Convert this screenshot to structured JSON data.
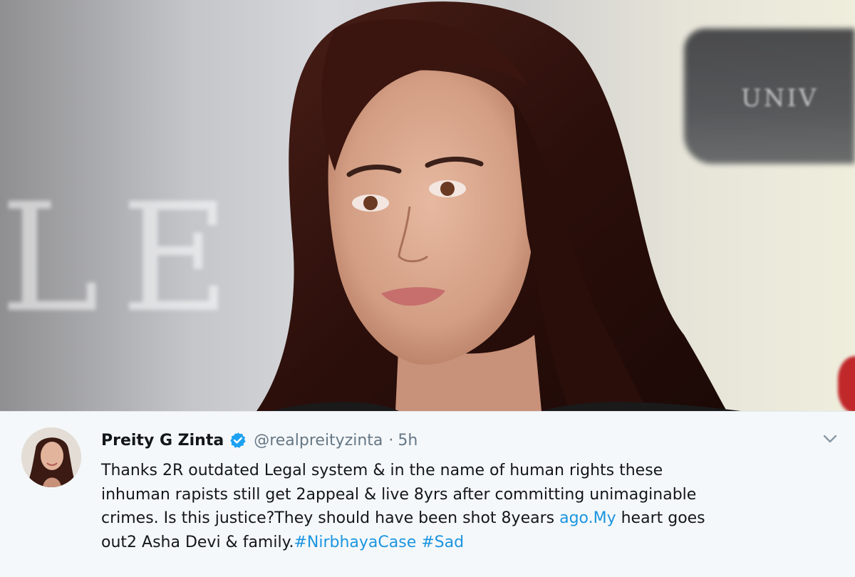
{
  "photo": {
    "background_sign_text": "UNIV",
    "background_letters": "LE"
  },
  "tweet": {
    "author": {
      "display_name": "Preity G Zinta",
      "handle": "@realpreityzinta",
      "verified": true
    },
    "separator": "·",
    "time_ago": "5h",
    "text_lines": [
      "Thanks 2R outdated Legal system & in the name of human rights these",
      "inhuman rapists still get 2appeal & live 8yrs after committing unimaginable",
      "crimes. Is this justice?They should have been shot 8years ",
      "out2 Asha Devi & family."
    ],
    "link_text": "ago.My",
    "line3_tail": " heart goes",
    "hashtags": [
      "#NirbhayaCase",
      "#Sad"
    ],
    "menu_icon": "chevron-down-icon",
    "colors": {
      "link": "#1b95e0",
      "verified_badge": "#1da1f2",
      "background": "#f5f8fa",
      "text": "#14171a",
      "secondary_text": "#657786"
    }
  }
}
